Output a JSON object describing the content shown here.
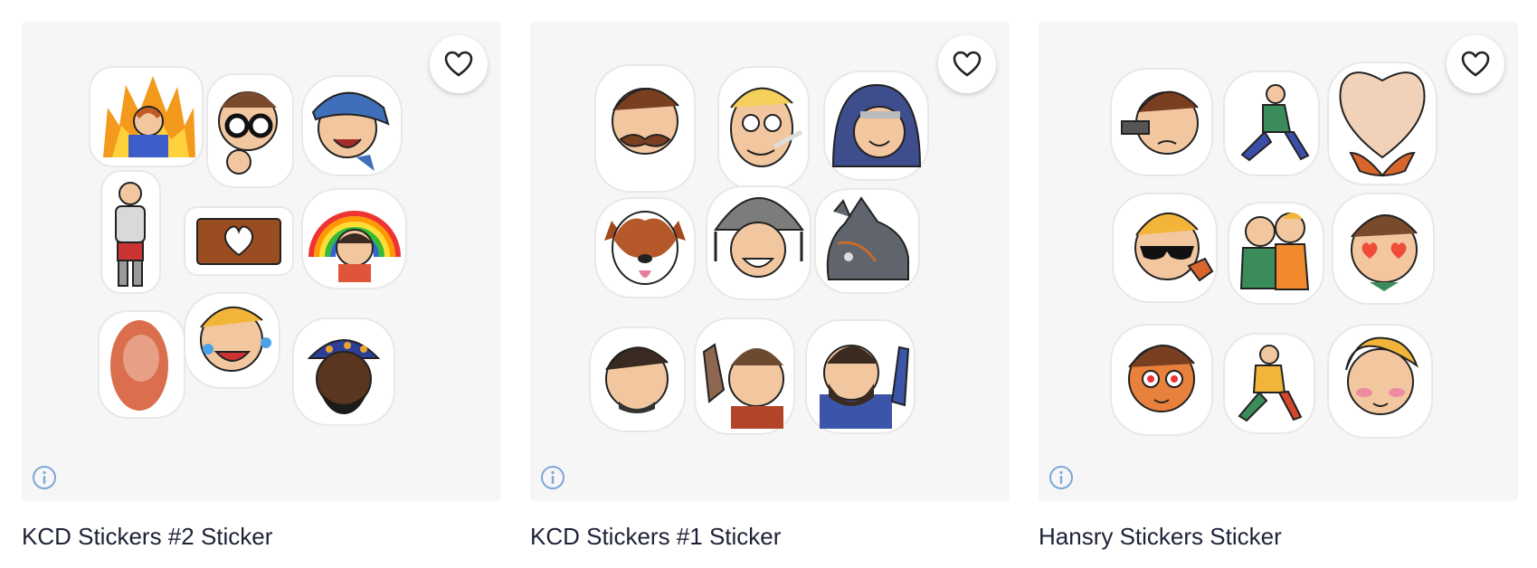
{
  "cards": [
    {
      "title": "KCD Stickers #2 Sticker",
      "favorite_icon": "heart-outline-icon",
      "info_icon": "info-circle-icon",
      "image_stickers": [
        "fire-face",
        "peeking-man",
        "blue-cap-man",
        "armored-knight",
        "heart-plank",
        "rainbow-kid",
        "blurry-ghost",
        "laughing-crying-blond",
        "turban-man"
      ]
    },
    {
      "title": "KCD Stickers #1 Sticker",
      "favorite_icon": "heart-outline-icon",
      "info_icon": "info-circle-icon",
      "image_stickers": [
        "mustache-man",
        "blond-pipe-man",
        "hooded-smirk",
        "dog",
        "helmet-man",
        "horse",
        "dark-hair-man",
        "waving-red-man",
        "waving-bearded-man"
      ]
    },
    {
      "title": "Hansry Stickers Sticker",
      "favorite_icon": "heart-outline-icon",
      "info_icon": "info-circle-icon",
      "image_stickers": [
        "gun-angry-man",
        "running-man",
        "heart-hands",
        "sunglasses-man",
        "hugging-pair",
        "heart-eyes-man",
        "heart-eyes-ginger",
        "running-jester",
        "blushing-blond"
      ]
    }
  ],
  "colors": {
    "card_bg": "#f6f6f6",
    "title_text": "#1e2237",
    "info_icon": "#7ea7d8",
    "heart_stroke": "#222222"
  }
}
